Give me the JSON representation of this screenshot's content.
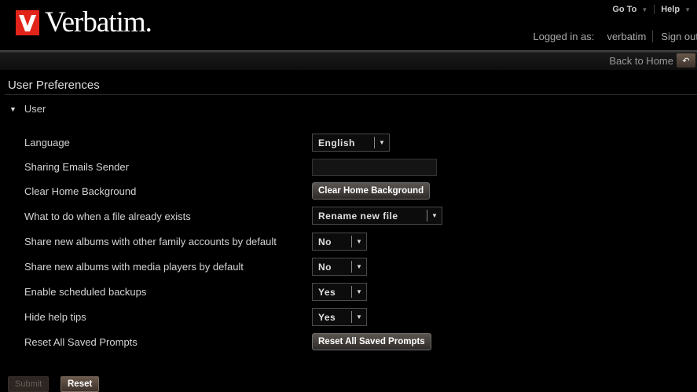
{
  "header": {
    "logo_text": "Verbatim.",
    "nav": {
      "goto_label": "Go To",
      "help_label": "Help"
    },
    "user": {
      "logged_in_label": "Logged in as:",
      "username": "verbatim",
      "signout_label": "Sign out"
    }
  },
  "crumbbar": {
    "back_home_label": "Back to Home"
  },
  "page": {
    "title": "User Preferences",
    "section_title": "User"
  },
  "preferences": {
    "language": {
      "label": "Language",
      "value": "English"
    },
    "sharing_emails_sender": {
      "label": "Sharing Emails Sender",
      "value": ""
    },
    "clear_home_background": {
      "label": "Clear Home Background",
      "button": "Clear Home Background"
    },
    "file_exists": {
      "label": "What to do when a file already exists",
      "value": "Rename new file"
    },
    "share_family": {
      "label": "Share new albums with other family accounts by default",
      "value": "No"
    },
    "share_media_players": {
      "label": "Share new albums with media players by default",
      "value": "No"
    },
    "scheduled_backups": {
      "label": "Enable scheduled backups",
      "value": "Yes"
    },
    "hide_help_tips": {
      "label": "Hide help tips",
      "value": "Yes"
    },
    "reset_prompts": {
      "label": "Reset All Saved Prompts",
      "button": "Reset All Saved Prompts"
    }
  },
  "footer": {
    "submit_label": "Submit",
    "reset_label": "Reset"
  },
  "colors": {
    "brand_red": "#e2231a",
    "background": "#000000",
    "button_brown": "#5a5450"
  },
  "icons": {
    "logo": "verbatim-v-logo-icon",
    "back": "back-arrow-icon",
    "dropdown": "chevron-down-icon",
    "section": "triangle-down-icon"
  }
}
